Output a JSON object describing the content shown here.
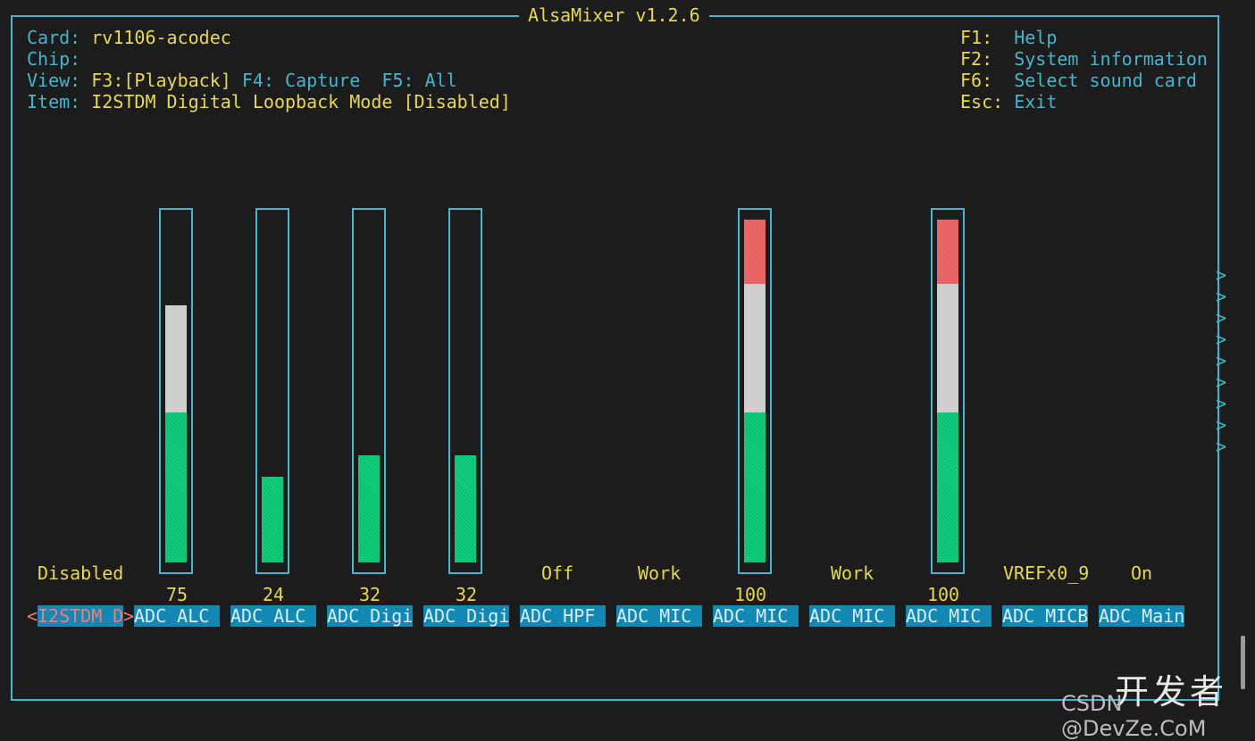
{
  "window_title": "AlsaMixer v1.2.6",
  "info": {
    "card_label": "Card:",
    "card_value": "rv1106-acodec",
    "chip_label": "Chip:",
    "chip_value": "",
    "view_label": "View:",
    "view_f3": "F3:[Playback]",
    "view_f4": "F4: Capture",
    "view_f5": "F5: All",
    "item_label": "Item:",
    "item_value": "I2STDM Digital Loopback Mode [Disabled]"
  },
  "help": [
    {
      "key": "F1:",
      "desc": "Help"
    },
    {
      "key": "F2:",
      "desc": "System information"
    },
    {
      "key": "F6:",
      "desc": "Select sound card"
    },
    {
      "key": "Esc:",
      "desc": "Exit"
    }
  ],
  "controls": [
    {
      "name": "I2STDM D",
      "state": "Disabled",
      "value": null,
      "selected": true
    },
    {
      "name": "ADC ALC",
      "state": "",
      "value": "75",
      "level": 0.75
    },
    {
      "name": "ADC ALC",
      "state": "",
      "value": "24",
      "level": 0.24
    },
    {
      "name": "ADC Digi",
      "state": "",
      "value": "32",
      "level": 0.32
    },
    {
      "name": "ADC Digi",
      "state": "",
      "value": "32",
      "level": 0.32
    },
    {
      "name": "ADC HPF",
      "state": "Off",
      "value": null
    },
    {
      "name": "ADC MIC",
      "state": "Work",
      "value": null
    },
    {
      "name": "ADC MIC",
      "state": "",
      "value": "100",
      "level": 1.0
    },
    {
      "name": "ADC MIC",
      "state": "Work",
      "value": null
    },
    {
      "name": "ADC MIC",
      "state": "",
      "value": "100",
      "level": 1.0
    },
    {
      "name": "ADC MICB",
      "state": "VREFx0_9",
      "value": null
    },
    {
      "name": "ADC Main",
      "state": "On",
      "value": null
    }
  ],
  "more_indicator": ">",
  "colors": {
    "frame": "#41b6cf",
    "value_text": "#e6d94a",
    "bar_green": "#0ecf7b",
    "bar_white": "#cfcfcf",
    "bar_red": "#f06868",
    "tag_bg": "#1288b4"
  },
  "watermark": {
    "line1": "开发者",
    "line2": "CSDN @DevZe.CoM"
  }
}
